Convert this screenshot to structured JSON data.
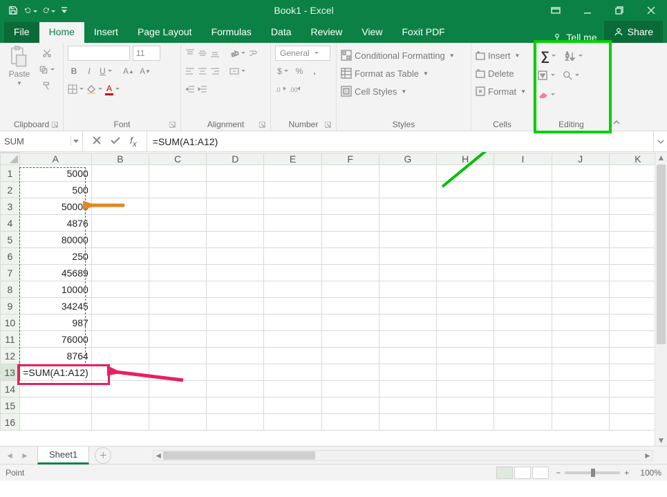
{
  "title": "Book1 - Excel",
  "qat": {
    "save": "save-icon",
    "undo": "undo-icon",
    "redo": "redo-icon"
  },
  "window_controls": {
    "options": "ribbon-options",
    "min": "minimize",
    "max": "restore",
    "close": "close"
  },
  "tabs": {
    "file": "File",
    "items": [
      "Home",
      "Insert",
      "Page Layout",
      "Formulas",
      "Data",
      "Review",
      "View",
      "Foxit PDF"
    ],
    "active": "Home",
    "tell_me": "Tell me",
    "share": "Share"
  },
  "ribbon": {
    "clipboard": {
      "paste": "Paste",
      "label": "Clipboard"
    },
    "font": {
      "name_ph": "",
      "size_ph": "11",
      "label": "Font"
    },
    "alignment": {
      "label": "Alignment"
    },
    "number": {
      "format": "General",
      "label": "Number"
    },
    "styles": {
      "cond": "Conditional Formatting",
      "table": "Format as Table",
      "cell": "Cell Styles",
      "label": "Styles"
    },
    "cells": {
      "insert": "Insert",
      "delete": "Delete",
      "format": "Format",
      "label": "Cells"
    },
    "editing": {
      "label": "Editing"
    }
  },
  "name_box": "SUM",
  "formula": "=SUM(A1:A12)",
  "columns": [
    "A",
    "B",
    "C",
    "D",
    "E",
    "F",
    "G",
    "H",
    "I",
    "J",
    "K"
  ],
  "rows_shown": 16,
  "col_A_data": [
    "5000",
    "500",
    "50000",
    "4876",
    "80000",
    "250",
    "45689",
    "10000",
    "34245",
    "987",
    "76000",
    "8764"
  ],
  "active_cell_text": "=SUM(A1:A12)",
  "active_cell_row": 13,
  "sheet_tabs": {
    "active": "Sheet1"
  },
  "status": {
    "mode": "Point",
    "zoom": "100%"
  },
  "annotations": {
    "editing_box": true,
    "green_arrow_to_autosum": true,
    "orange_arrow_row": 3,
    "pink_arrow_to_a13": true
  }
}
